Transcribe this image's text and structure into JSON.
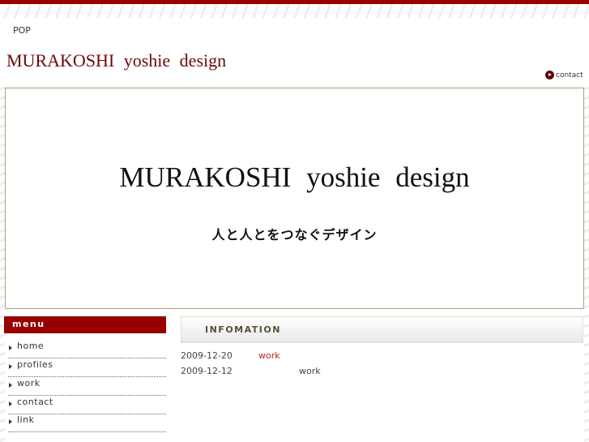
{
  "header": {
    "pop": "POP",
    "site_title": "MURAKOSHI  yoshie  design",
    "contact": "contact"
  },
  "hero": {
    "title": "MURAKOSHI  yoshie  design",
    "subtitle": "人と人とをつなぐデザイン"
  },
  "menu": {
    "title": "menu",
    "items": [
      {
        "label": "home"
      },
      {
        "label": "profiles"
      },
      {
        "label": "work"
      },
      {
        "label": "contact"
      },
      {
        "label": "link"
      }
    ]
  },
  "info": {
    "title": "INFOMATION",
    "rows": [
      {
        "date": "2009-12-20",
        "label": "work",
        "color": "#b22222"
      },
      {
        "date": "2009-12-12",
        "label": "work",
        "color": "#444444"
      }
    ]
  },
  "colors": {
    "accent": "#990000",
    "title": "#6b0a0a"
  }
}
